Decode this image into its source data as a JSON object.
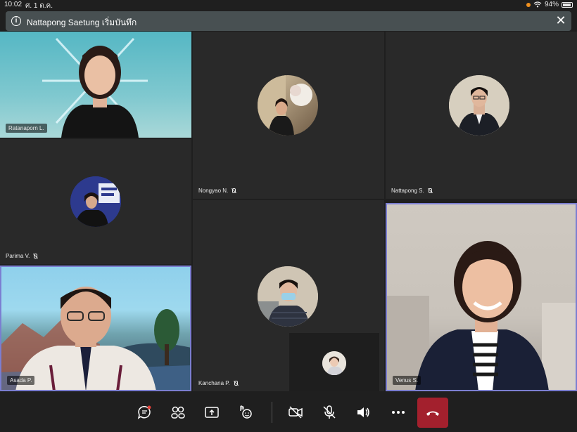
{
  "status": {
    "time": "10:02",
    "date": "ศ. 1 ต.ค.",
    "battery": "94%",
    "battery_level": 0.94
  },
  "banner": {
    "text": "Nattapong Saetung เริ่มบันทึก"
  },
  "participants": {
    "ratanaporn": {
      "name": "Ratanaporn L."
    },
    "nongyao": {
      "name": "Nongyao N."
    },
    "nattapong": {
      "name": "Nattapong S."
    },
    "parima": {
      "name": "Parima V."
    },
    "asada": {
      "name": "Asada P."
    },
    "kanchana": {
      "name": "Kanchana P."
    },
    "venus": {
      "name": "Venus S."
    }
  },
  "colors": {
    "active_border": "#7b7ed1",
    "hangup": "#a3202d",
    "background": "#1f1f1f",
    "tile": "#292929"
  },
  "toolbar": {
    "icons": [
      "chat-icon",
      "people-icon",
      "share-screen-icon",
      "reactions-icon",
      "camera-off-icon",
      "mic-off-icon",
      "speaker-icon",
      "more-icon",
      "hang-up-icon"
    ]
  }
}
